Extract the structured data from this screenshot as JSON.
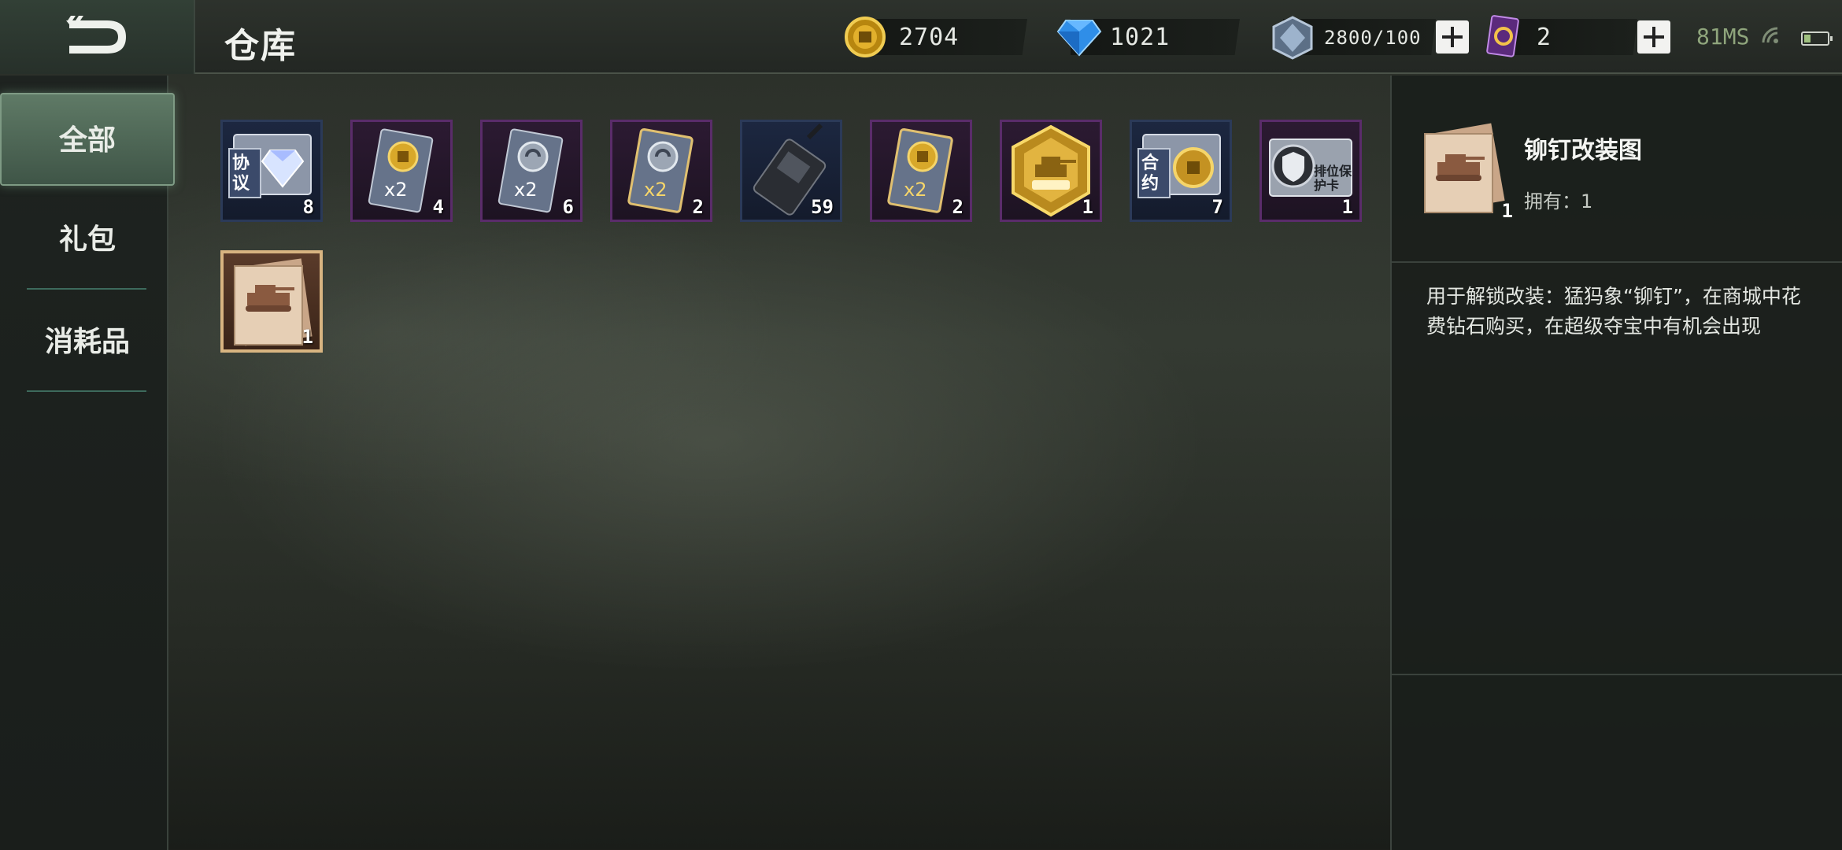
{
  "header": {
    "title": "仓库",
    "resources": [
      {
        "name": "gold",
        "value": "2704",
        "icon": "gold-coin-icon"
      },
      {
        "name": "diamond",
        "value": "1021",
        "icon": "diamond-icon"
      },
      {
        "name": "steel",
        "value": "2800/100",
        "icon": "steel-crystal-icon"
      },
      {
        "name": "card",
        "value": "2",
        "icon": "purple-card-icon"
      }
    ],
    "ping": "81MS"
  },
  "sidebar": {
    "tabs": [
      {
        "label": "全部",
        "active": true
      },
      {
        "label": "礼包",
        "active": false
      },
      {
        "label": "消耗品",
        "active": false
      }
    ]
  },
  "items": [
    {
      "icon": "protocol-diamond-card-icon",
      "label": "协议",
      "count": "8",
      "frame": "blue"
    },
    {
      "icon": "gold-x2-card-icon",
      "label": "x2",
      "count": "4",
      "frame": "purple"
    },
    {
      "icon": "silver-x2-card-icon",
      "label": "x2",
      "count": "6",
      "frame": "purple"
    },
    {
      "icon": "silver-x2-gold-card-icon",
      "label": "x2",
      "count": "2",
      "frame": "purple"
    },
    {
      "icon": "walkie-talkie-icon",
      "count": "59",
      "frame": "blue"
    },
    {
      "icon": "gold-x2-gold-card-icon",
      "label": "x2",
      "count": "2",
      "frame": "purple"
    },
    {
      "icon": "gold-medal-badge-icon",
      "count": "1",
      "frame": "purple"
    },
    {
      "icon": "contract-gold-coin-card-icon",
      "label": "合约",
      "count": "7",
      "frame": "blue"
    },
    {
      "icon": "rank-protect-card-icon",
      "label": "排位保护卡",
      "count": "1",
      "frame": "purple"
    },
    {
      "icon": "tank-blueprint-icon",
      "count": "1",
      "frame": "selected"
    }
  ],
  "detail": {
    "name": "铆钉改装图",
    "owned": "拥有：1",
    "count": "1",
    "description": "用于解锁改装：猛犸象“铆钉”，在商城中花费钻石购买，在超级夺宝中有机会出现"
  },
  "colors": {
    "accent_green": "#5f7a66",
    "frame_blue": "#2b3a58",
    "frame_purple": "#5a2c6a",
    "frame_selected": "#d8b481"
  }
}
